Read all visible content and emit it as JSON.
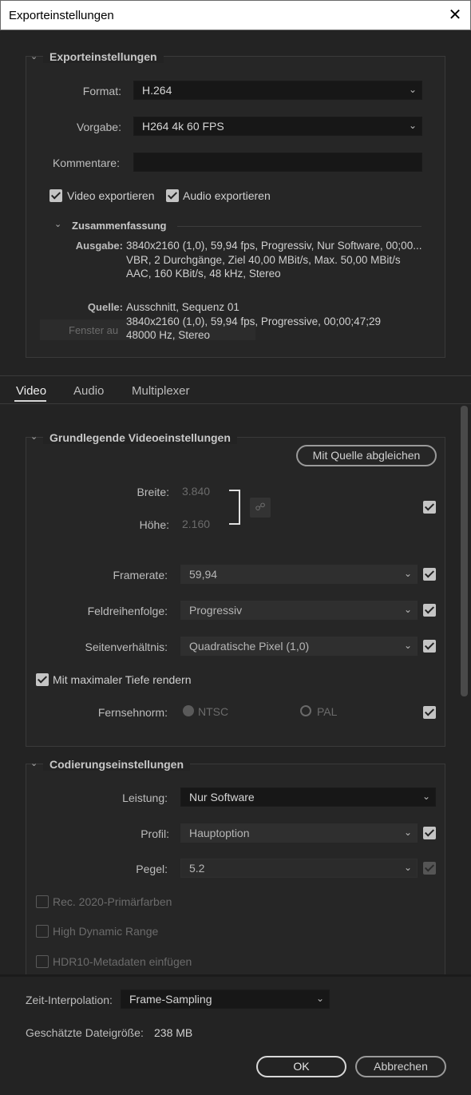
{
  "window": {
    "title": "Exporteinstellungen",
    "close_glyph": "✕"
  },
  "export_settings": {
    "header": "Exporteinstellungen",
    "format": {
      "label": "Format:",
      "value": "H.264"
    },
    "preset": {
      "label": "Vorgabe:",
      "value": "H264 4k 60 FPS"
    },
    "comments": {
      "label": "Kommentare:",
      "value": ""
    },
    "export_video": {
      "label": "Video exportieren",
      "checked": true
    },
    "export_audio": {
      "label": "Audio exportieren",
      "checked": true
    },
    "summary": {
      "header": "Zusammenfassung",
      "output_label": "Ausgabe:",
      "output_lines": [
        "3840x2160 (1,0), 59,94 fps, Progressiv, Nur Software, 00;00...",
        "VBR, 2 Durchgänge, Ziel 40,00 MBit/s, Max. 50,00 MBit/s",
        "AAC, 160 KBit/s, 48 kHz, Stereo"
      ],
      "source_label": "Quelle:",
      "source_lines": [
        "Ausschnitt, Sequenz 01",
        "3840x2160 (1,0), 59,94 fps, Progressive, 00;00;47;29",
        "48000 Hz, Stereo"
      ],
      "ghost_text": "Fenster au"
    }
  },
  "tabs": [
    {
      "label": "Video",
      "active": true
    },
    {
      "label": "Audio",
      "active": false
    },
    {
      "label": "Multiplexer",
      "active": false
    }
  ],
  "basic_video": {
    "header": "Grundlegende Videoeinstellungen",
    "match_source_button": "Mit Quelle abgleichen",
    "width": {
      "label": "Breite:",
      "value": "3.840"
    },
    "height": {
      "label": "Höhe:",
      "value": "2.160"
    },
    "framerate": {
      "label": "Framerate:",
      "value": "59,94"
    },
    "field_order": {
      "label": "Feldreihenfolge:",
      "value": "Progressiv"
    },
    "aspect": {
      "label": "Seitenverhältnis:",
      "value": "Quadratische Pixel (1,0)"
    },
    "max_depth": {
      "label": "Mit maximaler Tiefe rendern",
      "checked": true
    },
    "tv_standard": {
      "label": "Fernsehnorm:",
      "ntsc": "NTSC",
      "pal": "PAL",
      "selected": "NTSC"
    }
  },
  "encoding": {
    "header": "Codierungseinstellungen",
    "performance": {
      "label": "Leistung:",
      "value": "Nur Software"
    },
    "profile": {
      "label": "Profil:",
      "value": "Hauptoption"
    },
    "level": {
      "label": "Pegel:",
      "value": "5.2"
    },
    "rec2020": {
      "label": "Rec. 2020-Primärfarben",
      "checked": false
    },
    "hdr": {
      "label": "High Dynamic Range",
      "checked": false
    },
    "hdr10": {
      "label": "HDR10-Metadaten einfügen",
      "checked": false
    }
  },
  "footer": {
    "time_interp": {
      "label": "Zeit-Interpolation:",
      "value": "Frame-Sampling"
    },
    "filesize": {
      "label": "Geschätzte Dateigröße:",
      "value": "238 MB"
    },
    "ok_button": "OK",
    "cancel_button": "Abbrechen"
  },
  "icons": {
    "chevron_down": "chevron-down-icon",
    "link": "link-icon",
    "check": "checkmark-icon",
    "close": "close-icon"
  }
}
